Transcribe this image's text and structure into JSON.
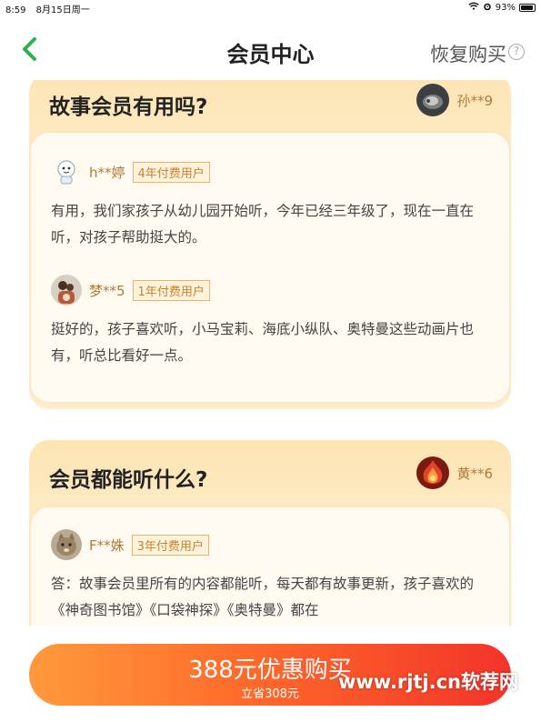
{
  "status_bar": {
    "time": "8:59",
    "date": "8月15日周一",
    "battery": "93%",
    "battery_fraction": 0.93
  },
  "nav": {
    "title": "会员中心",
    "restore_label": "恢复购买",
    "help_icon": "question-circle-icon"
  },
  "qa": [
    {
      "question": "故事会员有用吗?",
      "asker": "孙**9",
      "answers": [
        {
          "user": "h**婷",
          "tag": "4年付费用户",
          "text": "有用，我们家孩子从幼儿园开始听，今年已经三年级了，现在一直在听，对孩子帮助挺大的。"
        },
        {
          "user": "梦**5",
          "tag": "1年付费用户",
          "text": "挺好的，孩子喜欢听，小马宝莉、海底小纵队、奥特曼这些动画片也有，听总比看好一点。"
        }
      ]
    },
    {
      "question": "会员都能听什么?",
      "asker": "黄**6",
      "answers": [
        {
          "user": "F**姝",
          "tag": "3年付费用户",
          "text": "答：故事会员里所有的内容都能听，每天都有故事更新，孩子喜欢的《神奇图书馆》《口袋神探》《奥特曼》都在"
        }
      ]
    }
  ],
  "buy": {
    "main_label": "388元优惠购买",
    "sub_label": "立省308元"
  },
  "watermark": "www.rjtj.cn软荐网",
  "colors": {
    "accent_green": "#2bb24c",
    "card_bg": "#fde4b2",
    "tag_color": "#c9802a",
    "buy_gradient_start": "#ff9a3c",
    "buy_gradient_end": "#f2342a"
  }
}
